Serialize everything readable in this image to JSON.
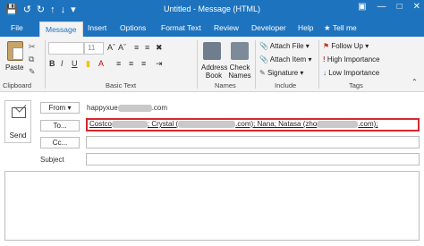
{
  "titlebar": {
    "title": "Untitled  -  Message (HTML)",
    "qat_icons": [
      "save-icon",
      "undo-icon",
      "redo-icon",
      "up-arrow-icon",
      "down-arrow-icon",
      "customize-icon"
    ],
    "win_buttons": [
      "ribbon-display-icon",
      "minimize-icon",
      "maximize-icon",
      "close-icon"
    ],
    "color": "#1e73be"
  },
  "tabs": [
    "File",
    "Message",
    "Insert",
    "Options",
    "Format Text",
    "Review",
    "Developer",
    "Help",
    "Tell me"
  ],
  "ribbon": {
    "clipboard": {
      "paste": "Paste",
      "group": "Clipboard"
    },
    "basic_text": {
      "font_size": "11",
      "group": "Basic Text",
      "bold": "B",
      "italic": "I",
      "underline": "U"
    },
    "names": {
      "address_book": "Address Book",
      "check_names": "Check Names",
      "group": "Names"
    },
    "include": {
      "attach_file": "Attach File",
      "attach_item": "Attach Item",
      "signature": "Signature",
      "group": "Include"
    },
    "tags": {
      "follow_up": "Follow Up",
      "high": "High Importance",
      "low": "Low Importance",
      "group": "Tags"
    }
  },
  "message": {
    "send": "Send",
    "from_button": "From",
    "from_value_prefix": "happyxue",
    "from_value_suffix": ".com",
    "to_button": "To...",
    "to_parts": {
      "p1": "Costco",
      "p2": "; Crystal (",
      "p3": ".com); Nana; Natasa (zho",
      "p4": ".com);"
    },
    "cc_button": "Cc...",
    "subject_label": "Subject"
  }
}
